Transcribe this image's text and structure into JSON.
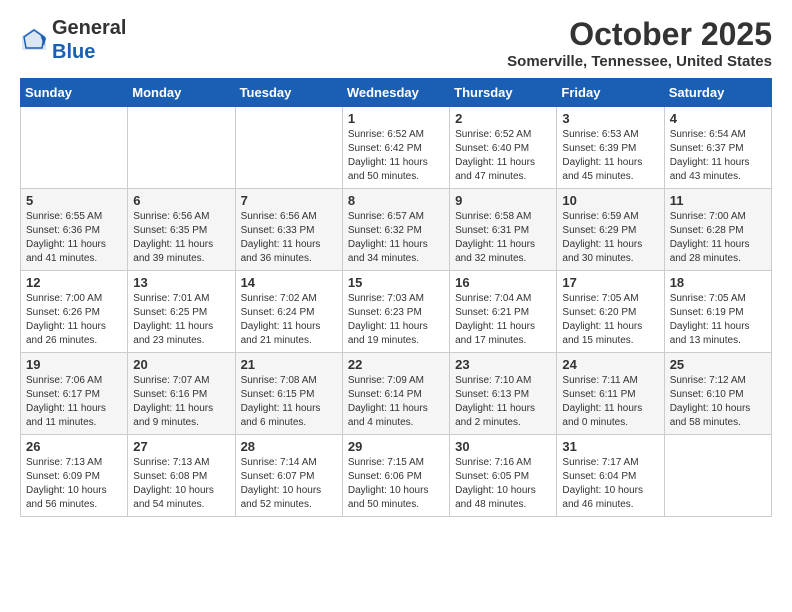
{
  "logo": {
    "general": "General",
    "blue": "Blue"
  },
  "header": {
    "month": "October 2025",
    "location": "Somerville, Tennessee, United States"
  },
  "weekdays": [
    "Sunday",
    "Monday",
    "Tuesday",
    "Wednesday",
    "Thursday",
    "Friday",
    "Saturday"
  ],
  "weeks": [
    [
      {
        "day": "",
        "info": ""
      },
      {
        "day": "",
        "info": ""
      },
      {
        "day": "",
        "info": ""
      },
      {
        "day": "1",
        "info": "Sunrise: 6:52 AM\nSunset: 6:42 PM\nDaylight: 11 hours\nand 50 minutes."
      },
      {
        "day": "2",
        "info": "Sunrise: 6:52 AM\nSunset: 6:40 PM\nDaylight: 11 hours\nand 47 minutes."
      },
      {
        "day": "3",
        "info": "Sunrise: 6:53 AM\nSunset: 6:39 PM\nDaylight: 11 hours\nand 45 minutes."
      },
      {
        "day": "4",
        "info": "Sunrise: 6:54 AM\nSunset: 6:37 PM\nDaylight: 11 hours\nand 43 minutes."
      }
    ],
    [
      {
        "day": "5",
        "info": "Sunrise: 6:55 AM\nSunset: 6:36 PM\nDaylight: 11 hours\nand 41 minutes."
      },
      {
        "day": "6",
        "info": "Sunrise: 6:56 AM\nSunset: 6:35 PM\nDaylight: 11 hours\nand 39 minutes."
      },
      {
        "day": "7",
        "info": "Sunrise: 6:56 AM\nSunset: 6:33 PM\nDaylight: 11 hours\nand 36 minutes."
      },
      {
        "day": "8",
        "info": "Sunrise: 6:57 AM\nSunset: 6:32 PM\nDaylight: 11 hours\nand 34 minutes."
      },
      {
        "day": "9",
        "info": "Sunrise: 6:58 AM\nSunset: 6:31 PM\nDaylight: 11 hours\nand 32 minutes."
      },
      {
        "day": "10",
        "info": "Sunrise: 6:59 AM\nSunset: 6:29 PM\nDaylight: 11 hours\nand 30 minutes."
      },
      {
        "day": "11",
        "info": "Sunrise: 7:00 AM\nSunset: 6:28 PM\nDaylight: 11 hours\nand 28 minutes."
      }
    ],
    [
      {
        "day": "12",
        "info": "Sunrise: 7:00 AM\nSunset: 6:26 PM\nDaylight: 11 hours\nand 26 minutes."
      },
      {
        "day": "13",
        "info": "Sunrise: 7:01 AM\nSunset: 6:25 PM\nDaylight: 11 hours\nand 23 minutes."
      },
      {
        "day": "14",
        "info": "Sunrise: 7:02 AM\nSunset: 6:24 PM\nDaylight: 11 hours\nand 21 minutes."
      },
      {
        "day": "15",
        "info": "Sunrise: 7:03 AM\nSunset: 6:23 PM\nDaylight: 11 hours\nand 19 minutes."
      },
      {
        "day": "16",
        "info": "Sunrise: 7:04 AM\nSunset: 6:21 PM\nDaylight: 11 hours\nand 17 minutes."
      },
      {
        "day": "17",
        "info": "Sunrise: 7:05 AM\nSunset: 6:20 PM\nDaylight: 11 hours\nand 15 minutes."
      },
      {
        "day": "18",
        "info": "Sunrise: 7:05 AM\nSunset: 6:19 PM\nDaylight: 11 hours\nand 13 minutes."
      }
    ],
    [
      {
        "day": "19",
        "info": "Sunrise: 7:06 AM\nSunset: 6:17 PM\nDaylight: 11 hours\nand 11 minutes."
      },
      {
        "day": "20",
        "info": "Sunrise: 7:07 AM\nSunset: 6:16 PM\nDaylight: 11 hours\nand 9 minutes."
      },
      {
        "day": "21",
        "info": "Sunrise: 7:08 AM\nSunset: 6:15 PM\nDaylight: 11 hours\nand 6 minutes."
      },
      {
        "day": "22",
        "info": "Sunrise: 7:09 AM\nSunset: 6:14 PM\nDaylight: 11 hours\nand 4 minutes."
      },
      {
        "day": "23",
        "info": "Sunrise: 7:10 AM\nSunset: 6:13 PM\nDaylight: 11 hours\nand 2 minutes."
      },
      {
        "day": "24",
        "info": "Sunrise: 7:11 AM\nSunset: 6:11 PM\nDaylight: 11 hours\nand 0 minutes."
      },
      {
        "day": "25",
        "info": "Sunrise: 7:12 AM\nSunset: 6:10 PM\nDaylight: 10 hours\nand 58 minutes."
      }
    ],
    [
      {
        "day": "26",
        "info": "Sunrise: 7:13 AM\nSunset: 6:09 PM\nDaylight: 10 hours\nand 56 minutes."
      },
      {
        "day": "27",
        "info": "Sunrise: 7:13 AM\nSunset: 6:08 PM\nDaylight: 10 hours\nand 54 minutes."
      },
      {
        "day": "28",
        "info": "Sunrise: 7:14 AM\nSunset: 6:07 PM\nDaylight: 10 hours\nand 52 minutes."
      },
      {
        "day": "29",
        "info": "Sunrise: 7:15 AM\nSunset: 6:06 PM\nDaylight: 10 hours\nand 50 minutes."
      },
      {
        "day": "30",
        "info": "Sunrise: 7:16 AM\nSunset: 6:05 PM\nDaylight: 10 hours\nand 48 minutes."
      },
      {
        "day": "31",
        "info": "Sunrise: 7:17 AM\nSunset: 6:04 PM\nDaylight: 10 hours\nand 46 minutes."
      },
      {
        "day": "",
        "info": ""
      }
    ]
  ]
}
